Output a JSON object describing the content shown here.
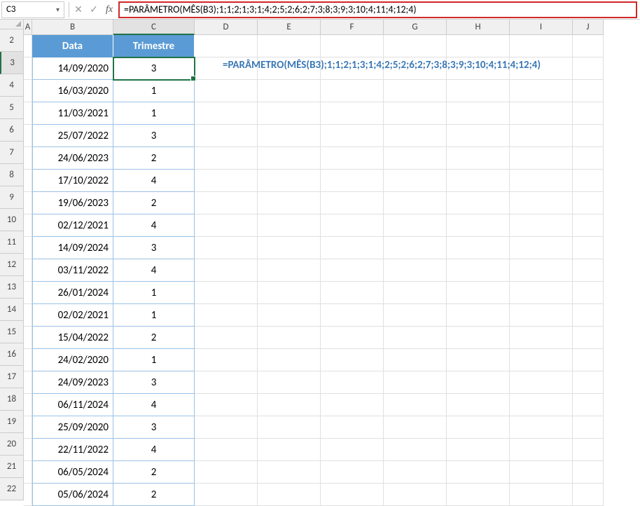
{
  "formula_bar": {
    "cell_ref": "C3",
    "formula": "=PARÂMETRO(MÊS(B3);1;1;2;1;3;1;4;2;5;2;6;2;7;3;8;3;9;3;10;4;11;4;12;4)"
  },
  "columns": [
    "A",
    "B",
    "C",
    "D",
    "E",
    "F",
    "G",
    "H",
    "I",
    "J"
  ],
  "row_numbers": [
    2,
    3,
    4,
    5,
    6,
    7,
    8,
    9,
    10,
    11,
    12,
    13,
    14,
    15,
    16,
    17,
    18,
    19,
    20,
    21,
    22
  ],
  "table": {
    "headers": {
      "data": "Data",
      "trimestre": "Trimestre"
    },
    "rows": [
      {
        "data": "14/09/2020",
        "trimestre": "3"
      },
      {
        "data": "16/03/2020",
        "trimestre": "1"
      },
      {
        "data": "11/03/2021",
        "trimestre": "1"
      },
      {
        "data": "25/07/2022",
        "trimestre": "3"
      },
      {
        "data": "24/06/2023",
        "trimestre": "2"
      },
      {
        "data": "17/10/2022",
        "trimestre": "4"
      },
      {
        "data": "19/06/2023",
        "trimestre": "2"
      },
      {
        "data": "02/12/2021",
        "trimestre": "4"
      },
      {
        "data": "14/09/2024",
        "trimestre": "3"
      },
      {
        "data": "03/11/2022",
        "trimestre": "4"
      },
      {
        "data": "26/01/2024",
        "trimestre": "1"
      },
      {
        "data": "02/02/2021",
        "trimestre": "1"
      },
      {
        "data": "15/04/2022",
        "trimestre": "2"
      },
      {
        "data": "24/02/2020",
        "trimestre": "1"
      },
      {
        "data": "24/09/2023",
        "trimestre": "3"
      },
      {
        "data": "06/11/2024",
        "trimestre": "4"
      },
      {
        "data": "25/09/2020",
        "trimestre": "3"
      },
      {
        "data": "22/11/2022",
        "trimestre": "4"
      },
      {
        "data": "06/05/2024",
        "trimestre": "2"
      },
      {
        "data": "05/06/2024",
        "trimestre": "2"
      }
    ]
  },
  "overlay_formula": "=PARÂMETRO(MÊS(B3);1;1;2;1;3;1;4;2;5;2;6;2;7;3;8;3;9;3;10;4;11;4;12;4)"
}
